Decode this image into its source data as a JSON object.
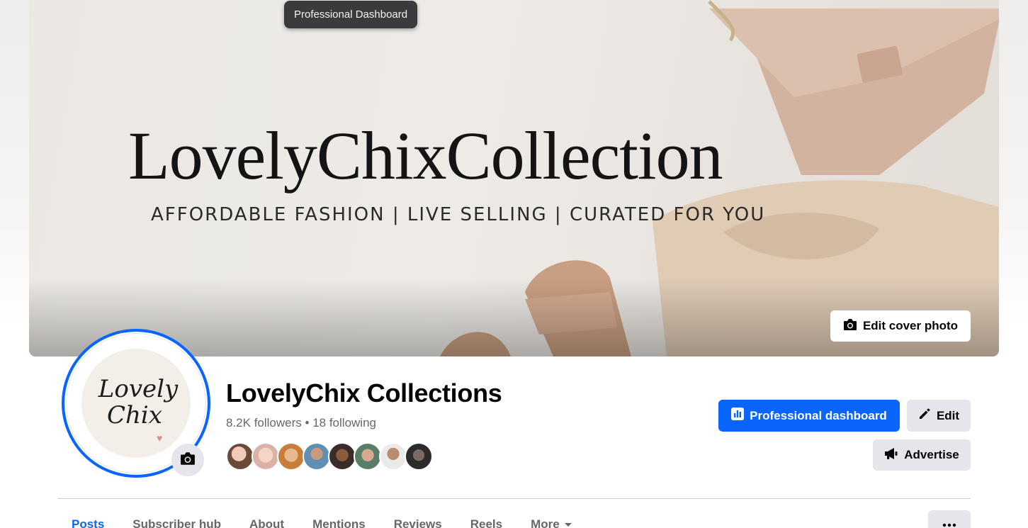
{
  "tooltip": "Professional Dashboard",
  "cover": {
    "title": "LovelyChixCollection",
    "tagline": "AFFORDABLE FASHION | LIVE SELLING | CURATED FOR YOU",
    "edit_label": "Edit cover photo"
  },
  "avatar": {
    "line1": "Lovely",
    "line2": "Chix"
  },
  "profile": {
    "name": "LovelyChix Collections",
    "followers": "8.2K followers",
    "separator": "•",
    "following": "18 following"
  },
  "actions": {
    "dashboard_label": "Professional dashboard",
    "edit_label": "Edit",
    "advertise_label": "Advertise"
  },
  "friends_count": 8,
  "tabs": [
    {
      "label": "Posts",
      "active": true
    },
    {
      "label": "Subscriber hub"
    },
    {
      "label": "About"
    },
    {
      "label": "Mentions"
    },
    {
      "label": "Reviews"
    },
    {
      "label": "Reels"
    },
    {
      "label": "More"
    }
  ],
  "colors": {
    "accent": "#0866ff",
    "secondary_text": "#65676b",
    "button_gray": "#e4e6eb"
  },
  "icons": [
    "camera-icon",
    "dashboard-icon",
    "pencil-icon",
    "megaphone-icon",
    "caret-down-icon",
    "ellipsis-icon"
  ]
}
